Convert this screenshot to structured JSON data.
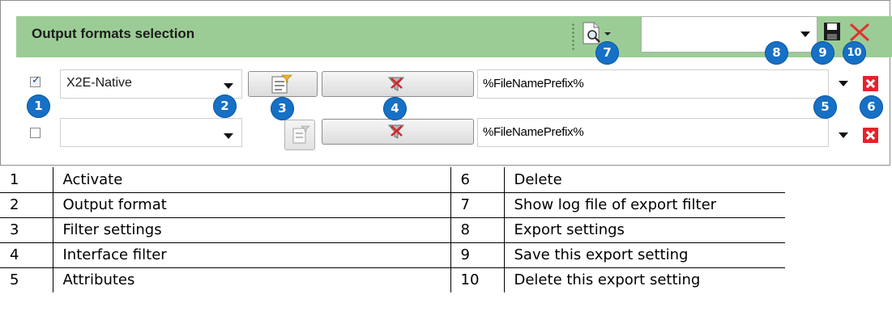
{
  "panel": {
    "title": "Output formats selection",
    "export_setting_value": ""
  },
  "rows": [
    {
      "checked": true,
      "format": "X2E-Native",
      "attributes": "%FileNamePrefix%"
    },
    {
      "checked": false,
      "format": "",
      "attributes": "%FileNamePrefix%"
    }
  ],
  "badges": [
    "1",
    "2",
    "3",
    "4",
    "5",
    "6",
    "7",
    "8",
    "9",
    "10"
  ],
  "icons": [
    "log-file-icon",
    "save-icon",
    "delete-setting-icon",
    "filter-settings-icon",
    "interface-filter-icon",
    "delete-icon"
  ],
  "colors": {
    "header": "#9ccc96",
    "badge": "#1670c6",
    "delete": "#e8212a"
  },
  "legend": [
    {
      "n1": "1",
      "t1": "Activate",
      "n2": "6",
      "t2": "Delete"
    },
    {
      "n1": "2",
      "t1": "Output format",
      "n2": "7",
      "t2": "Show log file of export filter"
    },
    {
      "n1": "3",
      "t1": "Filter settings",
      "n2": "8",
      "t2": "Export settings"
    },
    {
      "n1": "4",
      "t1": "Interface filter",
      "n2": "9",
      "t2": "Save this export setting"
    },
    {
      "n1": "5",
      "t1": "Attributes",
      "n2": "10",
      "t2": "Delete this export setting"
    }
  ]
}
